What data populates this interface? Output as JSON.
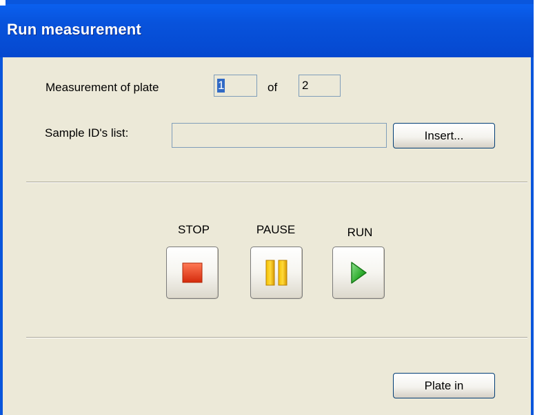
{
  "window": {
    "title": "Run measurement"
  },
  "plate": {
    "label": "Measurement of plate",
    "current": "1",
    "of_label": "of",
    "total": "2"
  },
  "sample": {
    "label": "Sample ID's list:",
    "value": "",
    "insert_label": "Insert..."
  },
  "controls": {
    "stop_label": "STOP",
    "pause_label": "PAUSE",
    "run_label": "RUN",
    "stop_icon": "stop-square-icon",
    "pause_icon": "pause-bars-icon",
    "run_icon": "play-triangle-icon",
    "stop_color": "#e8401c",
    "pause_color": "#f0b400",
    "run_color": "#2fae2f"
  },
  "footer": {
    "plate_in_label": "Plate in"
  },
  "colors": {
    "titlebar": "#0548cf",
    "client_bg": "#ece9d8"
  }
}
